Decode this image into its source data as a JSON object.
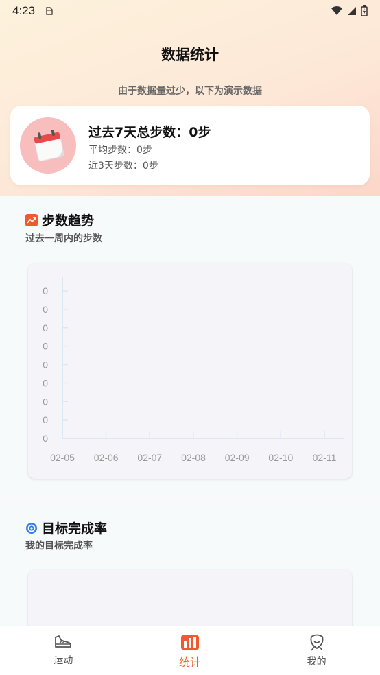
{
  "status_bar": {
    "time": "4:23"
  },
  "header": {
    "title": "数据统计",
    "demo_note": "由于数据量过少，以下为演示数据"
  },
  "summary": {
    "title": "过去7天总步数：0步",
    "avg_line": "平均步数：0步",
    "recent_line": "近3天步数：0步"
  },
  "trend_section": {
    "title": "步数趋势",
    "subtitle": "过去一周内的步数"
  },
  "goal_section": {
    "title": "目标完成率",
    "subtitle": "我的目标完成率"
  },
  "chart_data": {
    "type": "line",
    "title": "",
    "xlabel": "",
    "ylabel": "",
    "categories": [
      "02-05",
      "02-06",
      "02-07",
      "02-08",
      "02-09",
      "02-10",
      "02-11"
    ],
    "y_tick_labels": [
      "0",
      "0",
      "0",
      "0",
      "0",
      "0",
      "0",
      "0",
      "0"
    ],
    "values": [
      0,
      0,
      0,
      0,
      0,
      0,
      0
    ],
    "ylim": [
      0,
      0
    ],
    "grid": false
  },
  "bottom_nav": {
    "items": [
      {
        "label": "运动",
        "icon": "sneaker-icon"
      },
      {
        "label": "统计",
        "icon": "bar-chart-icon"
      },
      {
        "label": "我的",
        "icon": "profile-icon"
      }
    ],
    "active_index": 1,
    "active_color": "#f15a2a"
  },
  "colors": {
    "accent": "#f15a2a",
    "calendar_bg": "#f8bdbd",
    "trend_icon": "#f15a2a",
    "goal_icon": "#2f80ed"
  }
}
